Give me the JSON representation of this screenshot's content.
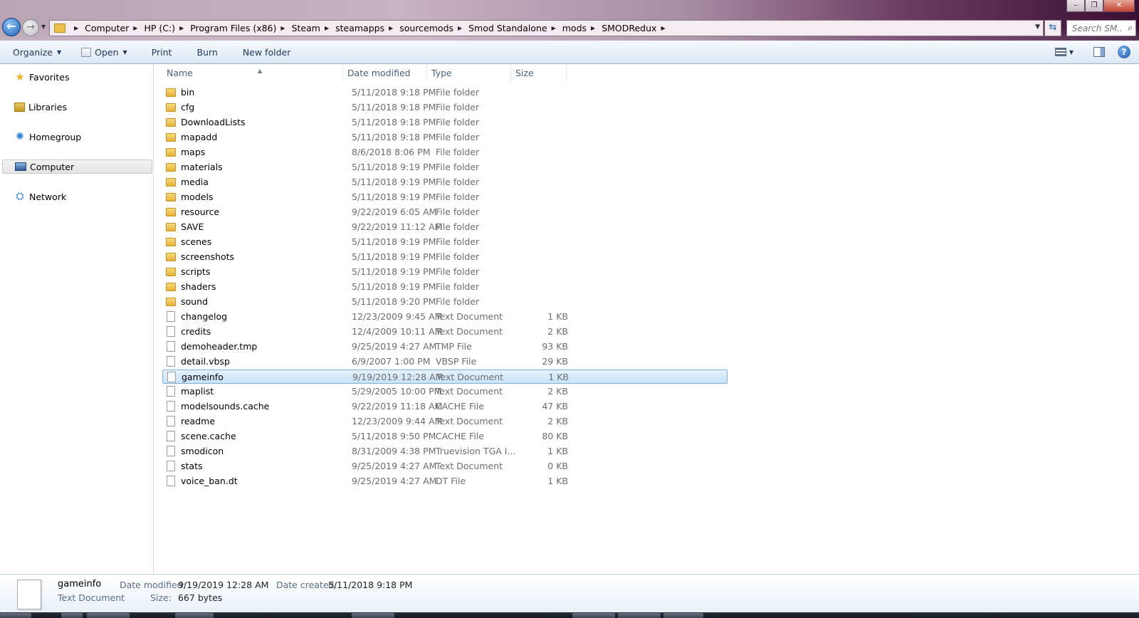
{
  "window": {
    "controls": {
      "minimize": "–",
      "maximize": "❐",
      "close": "✕"
    }
  },
  "address_bar": {
    "breadcrumbs": [
      "Computer",
      "HP (C:)",
      "Program Files (x86)",
      "Steam",
      "steamapps",
      "sourcemods",
      "Smod Standalone",
      "mods",
      "SMODRedux"
    ],
    "search_placeholder": "Search SM..."
  },
  "toolbar": {
    "organize": "Organize",
    "open": "Open",
    "print": "Print",
    "burn": "Burn",
    "new_folder": "New folder"
  },
  "nav_pane": {
    "items": [
      {
        "label": "Favorites",
        "icon": "star-icon"
      },
      {
        "label": "Libraries",
        "icon": "libraries-icon"
      },
      {
        "label": "Homegroup",
        "icon": "homegroup-icon"
      },
      {
        "label": "Computer",
        "icon": "computer-icon",
        "selected": true
      },
      {
        "label": "Network",
        "icon": "network-icon"
      }
    ]
  },
  "file_list": {
    "columns": {
      "name": "Name",
      "date": "Date modified",
      "type": "Type",
      "size": "Size"
    },
    "rows": [
      {
        "name": "bin",
        "date": "5/11/2018 9:18 PM",
        "type": "File folder",
        "size": "",
        "kind": "folder"
      },
      {
        "name": "cfg",
        "date": "5/11/2018 9:18 PM",
        "type": "File folder",
        "size": "",
        "kind": "folder"
      },
      {
        "name": "DownloadLists",
        "date": "5/11/2018 9:18 PM",
        "type": "File folder",
        "size": "",
        "kind": "folder"
      },
      {
        "name": "mapadd",
        "date": "5/11/2018 9:18 PM",
        "type": "File folder",
        "size": "",
        "kind": "folder"
      },
      {
        "name": "maps",
        "date": "8/6/2018 8:06 PM",
        "type": "File folder",
        "size": "",
        "kind": "folder"
      },
      {
        "name": "materials",
        "date": "5/11/2018 9:19 PM",
        "type": "File folder",
        "size": "",
        "kind": "folder"
      },
      {
        "name": "media",
        "date": "5/11/2018 9:19 PM",
        "type": "File folder",
        "size": "",
        "kind": "folder"
      },
      {
        "name": "models",
        "date": "5/11/2018 9:19 PM",
        "type": "File folder",
        "size": "",
        "kind": "folder"
      },
      {
        "name": "resource",
        "date": "9/22/2019 6:05 AM",
        "type": "File folder",
        "size": "",
        "kind": "folder"
      },
      {
        "name": "SAVE",
        "date": "9/22/2019 11:12 AM",
        "type": "File folder",
        "size": "",
        "kind": "folder"
      },
      {
        "name": "scenes",
        "date": "5/11/2018 9:19 PM",
        "type": "File folder",
        "size": "",
        "kind": "folder"
      },
      {
        "name": "screenshots",
        "date": "5/11/2018 9:19 PM",
        "type": "File folder",
        "size": "",
        "kind": "folder"
      },
      {
        "name": "scripts",
        "date": "5/11/2018 9:19 PM",
        "type": "File folder",
        "size": "",
        "kind": "folder"
      },
      {
        "name": "shaders",
        "date": "5/11/2018 9:19 PM",
        "type": "File folder",
        "size": "",
        "kind": "folder"
      },
      {
        "name": "sound",
        "date": "5/11/2018 9:20 PM",
        "type": "File folder",
        "size": "",
        "kind": "folder"
      },
      {
        "name": "changelog",
        "date": "12/23/2009 9:45 AM",
        "type": "Text Document",
        "size": "1 KB",
        "kind": "file"
      },
      {
        "name": "credits",
        "date": "12/4/2009 10:11 AM",
        "type": "Text Document",
        "size": "2 KB",
        "kind": "file"
      },
      {
        "name": "demoheader.tmp",
        "date": "9/25/2019 4:27 AM",
        "type": "TMP File",
        "size": "93 KB",
        "kind": "file"
      },
      {
        "name": "detail.vbsp",
        "date": "6/9/2007 1:00 PM",
        "type": "VBSP File",
        "size": "29 KB",
        "kind": "file"
      },
      {
        "name": "gameinfo",
        "date": "9/19/2019 12:28 AM",
        "type": "Text Document",
        "size": "1 KB",
        "kind": "file",
        "selected": true
      },
      {
        "name": "maplist",
        "date": "5/29/2005 10:00 PM",
        "type": "Text Document",
        "size": "2 KB",
        "kind": "file"
      },
      {
        "name": "modelsounds.cache",
        "date": "9/22/2019 11:18 AM",
        "type": "CACHE File",
        "size": "47 KB",
        "kind": "file"
      },
      {
        "name": "readme",
        "date": "12/23/2009 9:44 AM",
        "type": "Text Document",
        "size": "2 KB",
        "kind": "file"
      },
      {
        "name": "scene.cache",
        "date": "5/11/2018 9:50 PM",
        "type": "CACHE File",
        "size": "80 KB",
        "kind": "file"
      },
      {
        "name": "smodicon",
        "date": "8/31/2009 4:38 PM",
        "type": "Truevision TGA I...",
        "size": "1 KB",
        "kind": "file"
      },
      {
        "name": "stats",
        "date": "9/25/2019 4:27 AM",
        "type": "Text Document",
        "size": "0 KB",
        "kind": "file"
      },
      {
        "name": "voice_ban.dt",
        "date": "9/25/2019 4:27 AM",
        "type": "DT File",
        "size": "1 KB",
        "kind": "file"
      }
    ]
  },
  "details_pane": {
    "name": "gameinfo",
    "kind": "Text Document",
    "date_modified_label": "Date modified:",
    "date_modified": "9/19/2019 12:28 AM",
    "date_created_label": "Date created:",
    "date_created": "5/11/2018 9:18 PM",
    "size_label": "Size:",
    "size": "667 bytes"
  },
  "colors": {
    "selection_fill": "#c9e2f9",
    "selection_border": "#7fb0e3",
    "header_text": "#4c607a",
    "toolbar_text": "#1e395b"
  }
}
